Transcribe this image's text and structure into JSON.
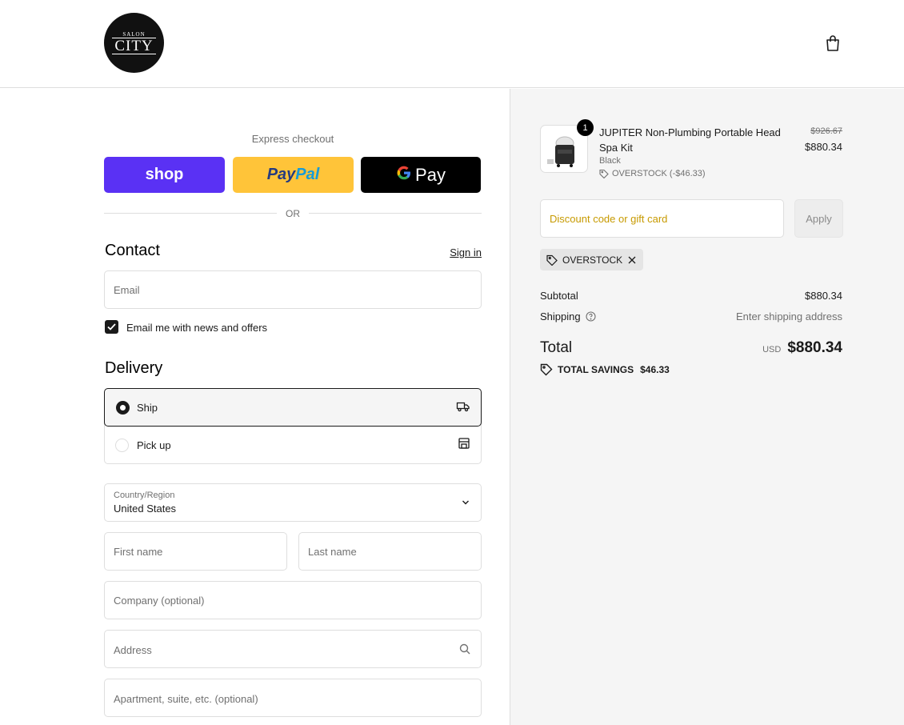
{
  "header": {
    "logo_top": "SALON",
    "logo_main": "CITY",
    "cart_icon": "shopping-bag-icon"
  },
  "express": {
    "label": "Express checkout",
    "shop_label": "shop",
    "paypal_part1": "Pay",
    "paypal_part2": "Pal",
    "gpay_g": "G",
    "gpay_label": "Pay",
    "or": "OR"
  },
  "contact": {
    "title": "Contact",
    "signin": "Sign in",
    "email_placeholder": "Email",
    "newsletter_label": "Email me with news and offers",
    "newsletter_checked": true
  },
  "delivery": {
    "title": "Delivery",
    "options": [
      {
        "label": "Ship",
        "selected": true,
        "icon": "truck-icon"
      },
      {
        "label": "Pick up",
        "selected": false,
        "icon": "store-icon"
      }
    ],
    "country_label": "Country/Region",
    "country_value": "United States",
    "first_name": "First name",
    "last_name": "Last name",
    "company": "Company (optional)",
    "address": "Address",
    "apartment": "Apartment, suite, etc. (optional)"
  },
  "order": {
    "item": {
      "quantity": "1",
      "name": "JUPITER Non-Plumbing Portable Head Spa Kit",
      "variant": "Black",
      "discount": "OVERSTOCK (-$46.33)",
      "old_price": "$926.67",
      "price": "$880.34"
    },
    "discount_placeholder": "Discount code or gift card",
    "apply": "Apply",
    "applied_code": "OVERSTOCK",
    "subtotal_label": "Subtotal",
    "subtotal_value": "$880.34",
    "shipping_label": "Shipping",
    "shipping_value": "Enter shipping address",
    "total_label": "Total",
    "total_currency": "USD",
    "total_value": "$880.34",
    "savings_label": "TOTAL SAVINGS",
    "savings_value": "$46.33"
  },
  "colors": {
    "shop": "#5a31f4",
    "paypal": "#ffc439",
    "gpay": "#000000",
    "discount_placeholder": "#c79a00"
  }
}
